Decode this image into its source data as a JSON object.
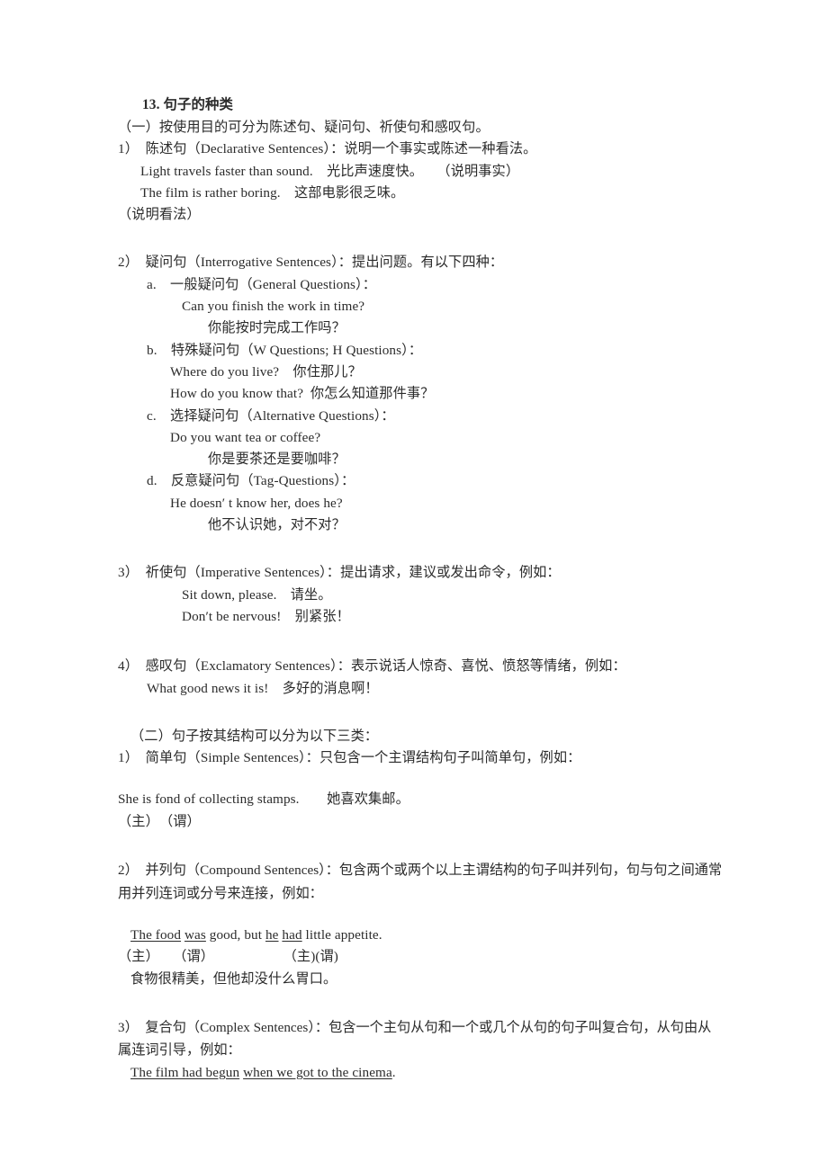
{
  "document": {
    "title": "13. 句子的种类",
    "sections": [
      {
        "id": "part-one",
        "intro": "（一）按使用目的可分为陈述句、疑问句、祈使句和感叹句。",
        "items": [
          {
            "marker": "1）",
            "head": "陈述句（Declarative Sentences）：说明一个事实或陈述一种看法。",
            "examples": [
              "Light travels faster than sound.　光比声速度快。　　（说明事实）",
              "The film is rather boring.　这部电影很乏味。",
              "（说明看法）"
            ]
          },
          {
            "marker": "2）",
            "head": "疑问句（Interrogative Sentences）：提出问题。有以下四种：",
            "subitems": [
              {
                "marker": "a.",
                "head": "一般疑问句（General Questions）：",
                "lines": [
                  "Can you finish the work in time?",
                  "你能按时完成工作吗？"
                ]
              },
              {
                "marker": "b.",
                "head": "特殊疑问句（W Questions; H Questions）：",
                "lines": [
                  "Where do you live?　你住那儿？",
                  "How do you know that?  你怎么知道那件事？"
                ]
              },
              {
                "marker": "c.",
                "head": "选择疑问句（Alternative Questions）：",
                "lines": [
                  "Do you want tea or coffee?",
                  "你是要茶还是要咖啡？"
                ]
              },
              {
                "marker": "d.",
                "head": "反意疑问句（Tag-Questions）：",
                "lines": [
                  "He doesn′ t know her, does he?",
                  "他不认识她，对不对？"
                ]
              }
            ]
          },
          {
            "marker": "3）",
            "head": "祈使句（Imperative Sentences）：提出请求，建议或发出命令，例如：",
            "examples": [
              "Sit down, please.　请坐。",
              "Don′t be nervous!　别紧张！"
            ]
          },
          {
            "marker": "4）",
            "head": "感叹句（Exclamatory Sentences）：表示说话人惊奇、喜悦、愤怒等情绪，例如：",
            "examples": [
              "What good news it is!　多好的消息啊！"
            ]
          }
        ]
      },
      {
        "id": "part-two",
        "intro": "（二）句子按其结构可以分为以下三类：",
        "items": [
          {
            "marker": "1）",
            "head": "简单句（Simple Sentences）：只包含一个主谓结构句子叫简单句，例如：",
            "examples": [
              "She is fond of collecting stamps.　　她喜欢集邮。",
              "（主）　（谓）"
            ]
          },
          {
            "marker": "2）",
            "head": "并列句（Compound Sentences）：包含两个或两个以上主谓结构的句子叫并列句，句与句之间通常用并列连词或分号来连接，例如：",
            "compound_example": {
              "parts": [
                {
                  "text": "The food",
                  "underline": true
                },
                {
                  "text": " ",
                  "underline": false
                },
                {
                  "text": "was",
                  "underline": true
                },
                {
                  "text": " good, but ",
                  "underline": false
                },
                {
                  "text": "he",
                  "underline": true
                },
                {
                  "text": " ",
                  "underline": false
                },
                {
                  "text": "had",
                  "underline": true
                },
                {
                  "text": " little appetite.",
                  "underline": false
                }
              ]
            },
            "labels_line": "（主）　　（谓）　　　　　　（主)(谓)",
            "translation": "食物很精美，但他却没什么胃口。"
          },
          {
            "marker": "3）",
            "head": "复合句（Complex Sentences）：包含一个主句从句和一个或几个从句的句子叫复合句，从句由从属连词引导，例如：",
            "complex_example": {
              "parts": [
                {
                  "text": "The film had begun",
                  "underline": true
                },
                {
                  "text": " ",
                  "underline": false
                },
                {
                  "text": "when we got to the cinema",
                  "underline": true
                },
                {
                  "text": ".",
                  "underline": false
                }
              ]
            }
          }
        ]
      }
    ]
  }
}
